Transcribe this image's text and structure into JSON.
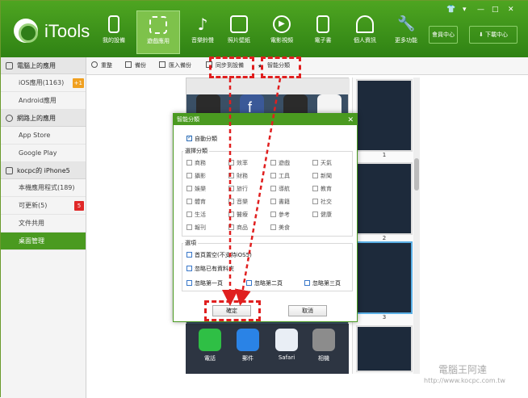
{
  "header": {
    "brand": "iTools",
    "nav": [
      {
        "label": "我的設備",
        "icon": "phone-icon"
      },
      {
        "label": "遊戲應用",
        "icon": "apps-grid-icon",
        "active": true
      },
      {
        "label": "音樂鈴聲",
        "icon": "music-note-icon"
      },
      {
        "label": "照片壁紙",
        "icon": "picture-icon"
      },
      {
        "label": "電影視頻",
        "icon": "play-icon"
      },
      {
        "label": "電子書",
        "icon": "book-icon"
      },
      {
        "label": "個人資訊",
        "icon": "person-icon"
      },
      {
        "label": "更多功能",
        "icon": "wrench-icon"
      }
    ],
    "member_center": "會員中心",
    "download_center": "下載中心",
    "window_controls": [
      "👕",
      "▾",
      "—",
      "□",
      "✕"
    ]
  },
  "sidebar": {
    "sections": [
      {
        "title": "電腦上的應用",
        "items": [
          {
            "label": "iOS應用(1163)",
            "badge": "+1"
          },
          {
            "label": "Android應用"
          }
        ]
      },
      {
        "title": "網路上的應用",
        "items": [
          {
            "label": "App Store"
          },
          {
            "label": "Google Play"
          }
        ]
      },
      {
        "title": "kocpc的 iPhone5",
        "items": [
          {
            "label": "本機應用程式(189)"
          },
          {
            "label": "可更新(5)",
            "badge": "5"
          },
          {
            "label": "文件共用"
          },
          {
            "label": "桌面管理"
          }
        ]
      }
    ]
  },
  "toolbar": {
    "refresh": "重整",
    "backup": "備份",
    "import_backup": "匯入備份",
    "sync_device": "同步到設備",
    "smart_classify": "智能分類"
  },
  "dock": [
    {
      "label": "電話",
      "icon": "phone-app-icon"
    },
    {
      "label": "郵件",
      "icon": "mail-app-icon"
    },
    {
      "label": "Safari",
      "icon": "safari-app-icon"
    },
    {
      "label": "相機",
      "icon": "camera-app-icon"
    }
  ],
  "thumbnails": [
    "1",
    "2",
    "3"
  ],
  "dialog": {
    "title": "智能分類",
    "auto_classify": "自動分類",
    "select_category": "選擇分類",
    "categories": [
      [
        "商務",
        "效率",
        "遊戲",
        "天氣"
      ],
      [
        "攝影",
        "財務",
        "工具",
        "新聞"
      ],
      [
        "娛樂",
        "旅行",
        "導航",
        "教育"
      ],
      [
        "體育",
        "音樂",
        "書籍",
        "社交"
      ],
      [
        "生活",
        "醫療",
        "參考",
        "健康"
      ],
      [
        "報刊",
        "商品",
        "美食"
      ]
    ],
    "options_title": "選項",
    "keep_home_empty": "首頁置空(不支持iOS5)",
    "ignore_existing_folders": "忽略已有資料夾",
    "ignore_page1": "忽略第一頁",
    "ignore_page2": "忽略第二頁",
    "ignore_page3": "忽略第三頁",
    "ok": "確定",
    "cancel": "取消"
  },
  "watermark": {
    "title": "電腦王阿達",
    "url": "http://www.kocpc.com.tw"
  },
  "colors": {
    "brand_green": "#3f9a1c",
    "annotation_red": "#e01f1f",
    "selected_thumb": "#5bb0e6"
  }
}
